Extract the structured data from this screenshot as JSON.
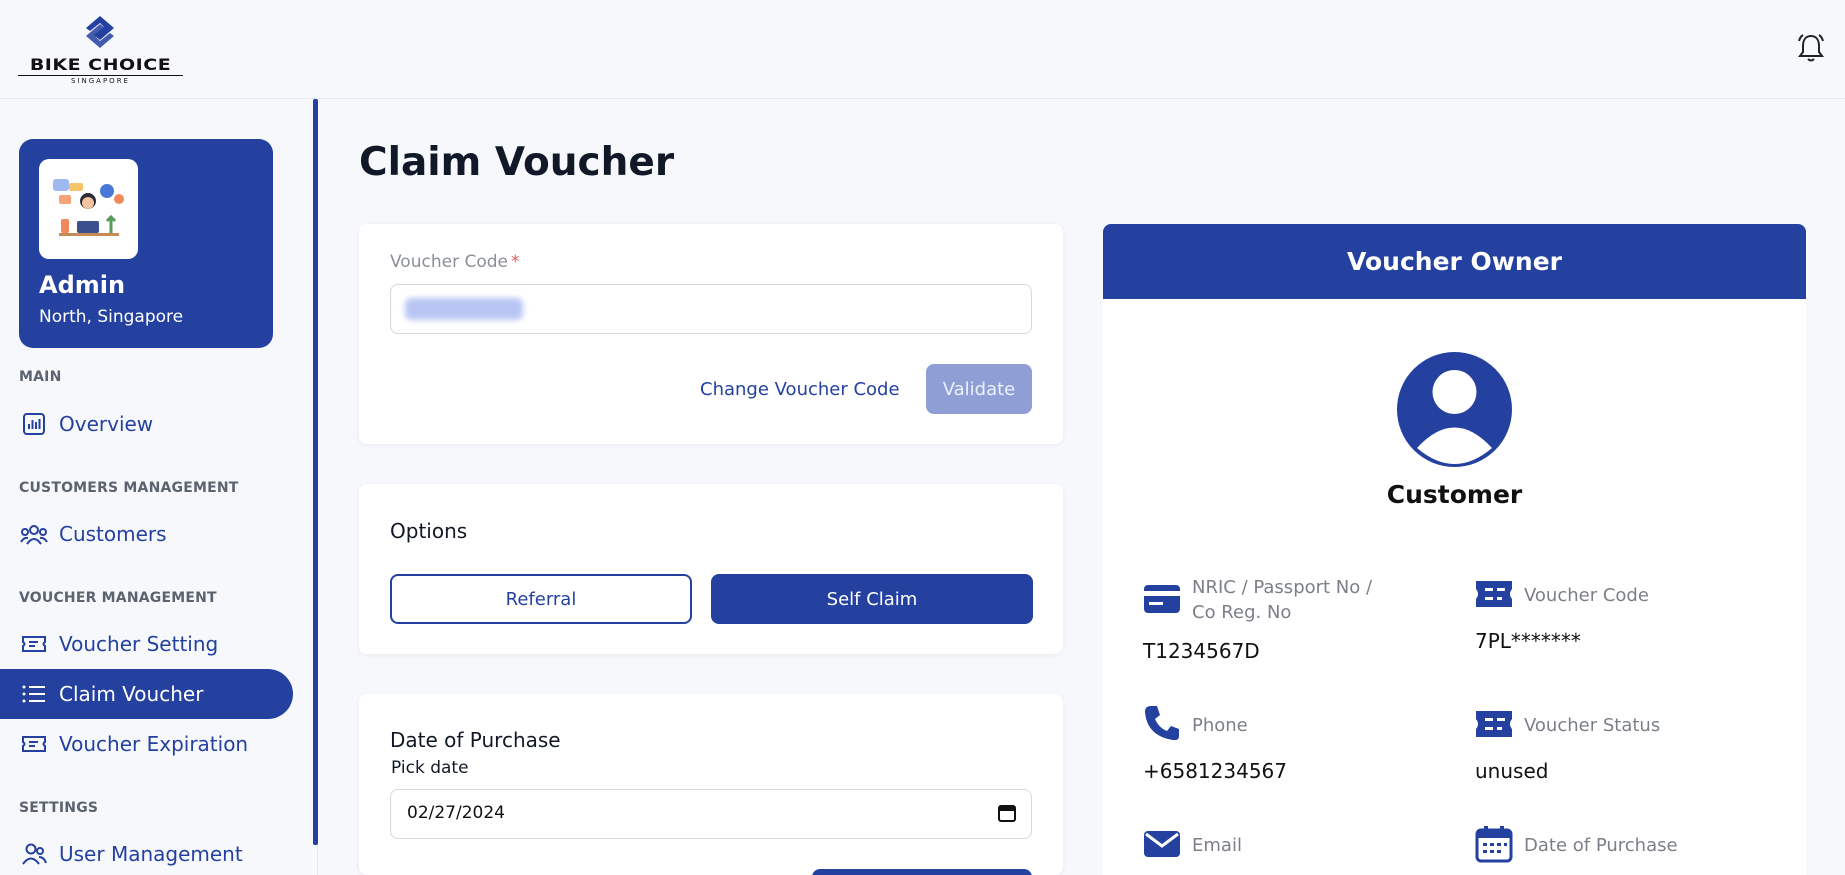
{
  "brand": {
    "name": "BIKE CHOICE",
    "sub": "SINGAPORE"
  },
  "profile": {
    "name": "Admin",
    "location": "North, Singapore"
  },
  "nav": {
    "sections": {
      "main": "MAIN",
      "customers": "CUSTOMERS MANAGEMENT",
      "vouchers": "VOUCHER MANAGEMENT",
      "settings": "SETTINGS"
    },
    "items": {
      "overview": "Overview",
      "customers": "Customers",
      "voucher_setting": "Voucher Setting",
      "claim_voucher": "Claim Voucher",
      "voucher_expiration": "Voucher Expiration",
      "user_management": "User Management"
    },
    "active": "claim_voucher"
  },
  "page": {
    "title": "Claim Voucher"
  },
  "voucher_form": {
    "label": "Voucher Code",
    "required_mark": "*",
    "change_label": "Change Voucher Code",
    "validate_label": "Validate"
  },
  "options": {
    "heading": "Options",
    "referral": "Referral",
    "self_claim": "Self Claim"
  },
  "purchase": {
    "heading": "Date of Purchase",
    "pick_label": "Pick date",
    "date_value": "02/27/2024"
  },
  "owner": {
    "title": "Voucher Owner",
    "name": "Customer",
    "fields": {
      "nric_label": "NRIC / Passport No /",
      "nric_label2": "Co Reg. No",
      "nric_value": "T1234567D",
      "code_label": "Voucher Code",
      "code_value": "7PL*******",
      "phone_label": "Phone",
      "phone_value": "+6581234567",
      "status_label": "Voucher Status",
      "status_value": "unused",
      "email_label": "Email",
      "dop_label": "Date of Purchase"
    }
  },
  "colors": {
    "primary": "#2441a0",
    "disabled": "#8f9fd6",
    "bg": "#f6f8fb"
  }
}
